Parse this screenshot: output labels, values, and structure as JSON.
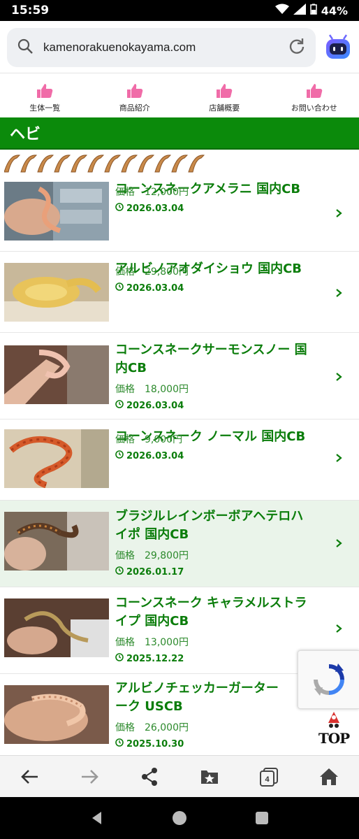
{
  "status": {
    "time": "15:59",
    "battery": "44%"
  },
  "browser": {
    "url": "kamenorakuenokayama.com",
    "tab_count": "4"
  },
  "nav": {
    "items": [
      {
        "label": "生体一覧"
      },
      {
        "label": "商品紹介"
      },
      {
        "label": "店舗概要"
      },
      {
        "label": "お問い合わせ"
      }
    ]
  },
  "category": {
    "title": "ヘビ"
  },
  "products": [
    {
      "title_l1": "コーンスネークアメラニ 国内CB",
      "title_l2": "",
      "price_label": "価格",
      "price": "12,000円",
      "date": "2026.03.04"
    },
    {
      "title_l1": "アルビノアオダイショウ 国内CB",
      "title_l2": "",
      "price_label": "価格",
      "price": "29,800円",
      "date": "2026.03.04"
    },
    {
      "title_l1": "コーンスネークサーモンスノー 国",
      "title_l2": "内CB",
      "price_label": "価格",
      "price": "18,000円",
      "date": "2026.03.04"
    },
    {
      "title_l1": "コーンスネーク ノーマル 国内CB",
      "title_l2": "",
      "price_label": "価格",
      "price": "9,000円",
      "date": "2026.03.04"
    },
    {
      "title_l1": "ブラジルレインボーボアヘテロハ",
      "title_l2": "イポ 国内CB",
      "price_label": "価格",
      "price": "29,800円",
      "date": "2026.01.17"
    },
    {
      "title_l1": "コーンスネーク キャラメルストラ",
      "title_l2": "イプ 国内CB",
      "price_label": "価格",
      "price": "13,000円",
      "date": "2025.12.22"
    },
    {
      "title_l1": "アルビノチェッカーガーター",
      "title_l2": "ーク USCB",
      "price_label": "価格",
      "price": "26,000円",
      "date": "2025.10.30"
    }
  ],
  "top_button": {
    "label": "TOP"
  },
  "colors": {
    "brand_green": "#0b8a0b",
    "title_green": "#0b7d0b",
    "nav_pink": "#f06ca8"
  }
}
